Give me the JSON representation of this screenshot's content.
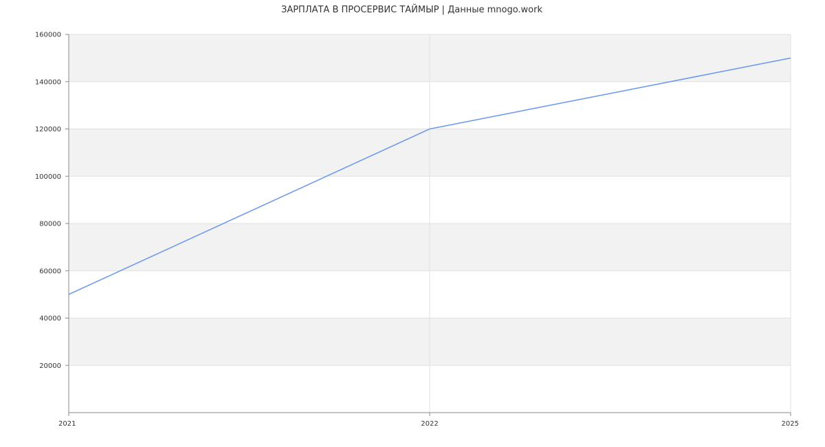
{
  "chart_data": {
    "type": "line",
    "title": "ЗАРПЛАТА В ПРОСЕРВИС ТАЙМЫР | Данные mnogo.work",
    "x": [
      "2021",
      "2022",
      "2025"
    ],
    "series": [
      {
        "values": [
          50000,
          120000,
          150000
        ]
      }
    ],
    "ylim": [
      0,
      160000
    ],
    "yticks": [
      20000,
      40000,
      60000,
      80000,
      100000,
      120000,
      140000,
      160000
    ],
    "xlabel": "",
    "ylabel": "",
    "grid": true,
    "banded_background": true,
    "legend": "none",
    "colors": {
      "line": "#6f9beb",
      "band": "#f2f2f2",
      "grid": "#e0e0e0",
      "axis": "#888888"
    }
  }
}
